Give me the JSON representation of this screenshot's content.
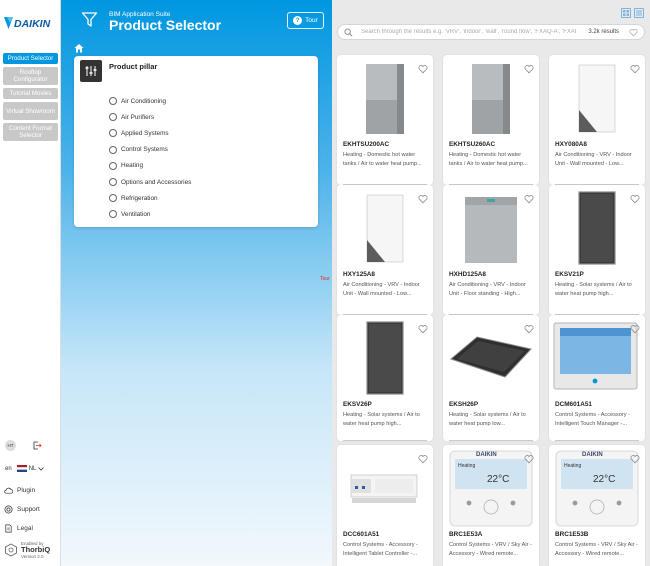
{
  "brand": {
    "logo_text": "DAIKIN",
    "accent": "#0097e0"
  },
  "sidebar": {
    "items": [
      {
        "label": "Product Selector",
        "active": true
      },
      {
        "label": "Rooftop Configurator",
        "active": false
      },
      {
        "label": "Tutorial Movies",
        "active": false
      },
      {
        "label": "Virtual Showroom",
        "active": false
      },
      {
        "label": "Content Format Selector",
        "active": false
      }
    ],
    "user_initials": "HT",
    "language": "en",
    "region": "NL",
    "links": {
      "plugin": "Plugin",
      "support": "Support",
      "legal": "Legal"
    },
    "credit": {
      "enabled_by": "Enabled by",
      "brand": "ThorbiQ",
      "version": "Version 2.0"
    }
  },
  "header": {
    "suite": "BIM Application Suite",
    "title": "Product Selector",
    "tour_label": "Tour",
    "toast": "Tour"
  },
  "filter": {
    "title": "Product pillar",
    "options": [
      "Air Conditioning",
      "Air Purifiers",
      "Applied Systems",
      "Control Systems",
      "Heating",
      "Options and Accessories",
      "Refrigeration",
      "Ventilation"
    ]
  },
  "search": {
    "placeholder": "Search through the results e.g. 'VRV', 'indoor', 'wall', 'round flow', 'FXAQ-A', 'FXAI",
    "count": "3.2k results"
  },
  "products": [
    {
      "code": "EKHTSU200AC",
      "desc": "Heating - Domestic hot water tanks / Air to water heat pump...",
      "img": "tall-grey"
    },
    {
      "code": "EKHTSU260AC",
      "desc": "Heating - Domestic hot water tanks / Air to water heat pump...",
      "img": "tall-grey"
    },
    {
      "code": "HXY080A8",
      "desc": "Air Conditioning - VRV - Indoor Unit - Wall mounted - Low...",
      "img": "white-unit"
    },
    {
      "code": "HXY125A8",
      "desc": "Air Conditioning - VRV - Indoor Unit - Wall mounted - Low...",
      "img": "white-unit"
    },
    {
      "code": "HXHD125A8",
      "desc": "Air Conditioning - VRV - Indoor Unit - Floor standing - High...",
      "img": "floor-grey"
    },
    {
      "code": "EKSV21P",
      "desc": "Heating - Solar systems / Air to water heat pump high...",
      "img": "solar-vertical"
    },
    {
      "code": "EKSV26P",
      "desc": "Heating - Solar systems / Air to water heat pump high...",
      "img": "solar-vertical"
    },
    {
      "code": "EKSH26P",
      "desc": "Heating - Solar systems / Air to water heat pump low...",
      "img": "solar-flat"
    },
    {
      "code": "DCM601A51",
      "desc": "Control Systems - Accessory - Intelligent Touch Manager -...",
      "img": "touch-screen"
    },
    {
      "code": "DCC601A51",
      "desc": "Control Systems - Accessory - Intelligent Tablet Controller -...",
      "img": "din-rail"
    },
    {
      "code": "BRC1E53A",
      "desc": "Control Systems - VRV / Sky Air - Accessory - Wired remote...",
      "img": "remote"
    },
    {
      "code": "BRC1E53B",
      "desc": "Control Systems - VRV / Sky Air - Accessory - Wired remote...",
      "img": "remote"
    }
  ],
  "remote_display": {
    "label": "Heating",
    "temp": "22°C"
  }
}
